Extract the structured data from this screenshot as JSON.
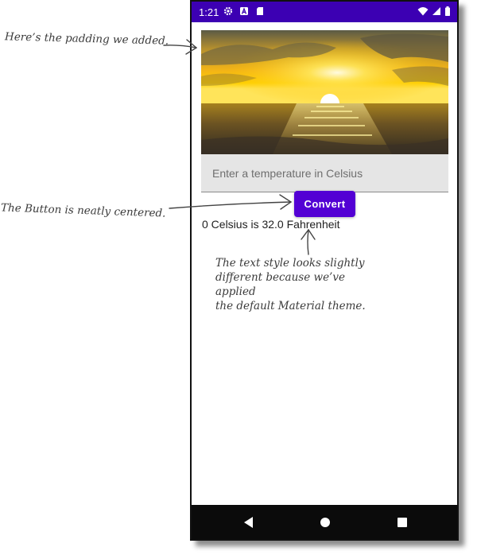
{
  "status_bar": {
    "time": "1:21",
    "left_icons": [
      "gear-icon",
      "a-notification-icon",
      "sd-card-icon"
    ],
    "right_icons": [
      "wifi-icon",
      "cell-signal-icon",
      "battery-icon"
    ],
    "color": "#3c00b3"
  },
  "app": {
    "hero_image": "sunset-over-sea",
    "temperature_field": {
      "placeholder": "Enter a temperature in Celsius",
      "value": ""
    },
    "convert_button": {
      "label": "Convert",
      "color": "#5300d4"
    },
    "result_text": "0 Celsius is 32.0 Fahrenheit"
  },
  "nav_bar": {
    "buttons": [
      "back-icon",
      "home-icon",
      "recents-icon"
    ]
  },
  "annotations": {
    "padding_note": "Here’s the padding we added.",
    "button_note": "The Button is neatly centered.",
    "style_note": {
      "line1": "The text style looks slightly",
      "line2": "different because we’ve applied",
      "line3": "the default Material theme."
    }
  }
}
